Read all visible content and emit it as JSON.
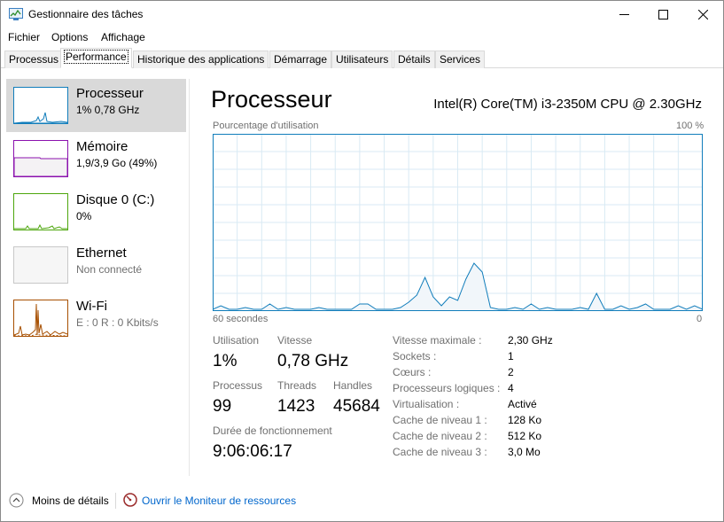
{
  "window": {
    "title": "Gestionnaire des tâches",
    "minimize_icon": "minimize-icon",
    "maximize_icon": "maximize-icon",
    "close_icon": "close-icon"
  },
  "menu": [
    "Fichier",
    "Options",
    "Affichage"
  ],
  "tabs": [
    "Processus",
    "Performance",
    "Historique des applications",
    "Démarrage",
    "Utilisateurs",
    "Détails",
    "Services"
  ],
  "active_tab": "Performance",
  "sidebar": {
    "items": [
      {
        "title": "Processeur",
        "subtitle": "1% 0,78 GHz",
        "color": "#117dbb"
      },
      {
        "title": "Mémoire",
        "subtitle": "1,9/3,9 Go (49%)",
        "color": "#8b12ae"
      },
      {
        "title": "Disque 0 (C:)",
        "subtitle": "0%",
        "color": "#4da60c"
      },
      {
        "title": "Ethernet",
        "subtitle": "Non connecté",
        "color": "#a74f01"
      },
      {
        "title": "Wi-Fi",
        "subtitle": "E : 0 R : 0 Kbits/s",
        "color": "#a74f01"
      }
    ]
  },
  "main": {
    "title": "Processeur",
    "cpu_name": "Intel(R) Core(TM) i3-2350M CPU @ 2.30GHz",
    "graph_top_left": "Pourcentage d'utilisation",
    "graph_top_right": "100 %",
    "graph_bottom_left": "60 secondes",
    "graph_bottom_right": "0",
    "stats": {
      "utilisation_label": "Utilisation",
      "utilisation_value": "1%",
      "vitesse_label": "Vitesse",
      "vitesse_value": "0,78 GHz",
      "processus_label": "Processus",
      "processus_value": "99",
      "threads_label": "Threads",
      "threads_value": "1423",
      "handles_label": "Handles",
      "handles_value": "45684",
      "uptime_label": "Durée de fonctionnement",
      "uptime_value": "9:06:06:17"
    },
    "details": [
      {
        "label": "Vitesse maximale :",
        "value": "2,30 GHz"
      },
      {
        "label": "Sockets :",
        "value": "1"
      },
      {
        "label": "Cœurs :",
        "value": "2"
      },
      {
        "label": "Processeurs logiques :",
        "value": "4"
      },
      {
        "label": "Virtualisation :",
        "value": "Activé"
      },
      {
        "label": "Cache de niveau 1 :",
        "value": "128 Ko"
      },
      {
        "label": "Cache de niveau 2 :",
        "value": "512 Ko"
      },
      {
        "label": "Cache de niveau 3 :",
        "value": "3,0 Mo"
      }
    ]
  },
  "footer": {
    "less_details": "Moins de détails",
    "resource_monitor": "Ouvrir le Moniteur de ressources"
  },
  "colors": {
    "cpu_line": "#117dbb",
    "cpu_fill": "#f1f6fa",
    "grid": "#d9eaf4",
    "link": "#0066cc"
  },
  "chart_data": {
    "type": "area",
    "title": "",
    "xlabel": "60 secondes",
    "ylabel": "Pourcentage d'utilisation",
    "ylim": [
      0,
      100
    ],
    "x": [
      60,
      59,
      58,
      57,
      56,
      55,
      54,
      53,
      52,
      51,
      50,
      49,
      48,
      47,
      46,
      45,
      44,
      43,
      42,
      41,
      40,
      39,
      38,
      37,
      36,
      35,
      34,
      33,
      32,
      31,
      30,
      29,
      28,
      27,
      26,
      25,
      24,
      23,
      22,
      21,
      20,
      19,
      18,
      17,
      16,
      15,
      14,
      13,
      12,
      11,
      10,
      9,
      8,
      7,
      6,
      5,
      4,
      3,
      2,
      1,
      0
    ],
    "series": [
      {
        "values": [
          1,
          3,
          1,
          1,
          2,
          1,
          1,
          4,
          1,
          2,
          1,
          1,
          1,
          2,
          1,
          1,
          1,
          1,
          4,
          4,
          1,
          1,
          1,
          2,
          5,
          9,
          19,
          8,
          3,
          8,
          6,
          18,
          27,
          22,
          2,
          1,
          1,
          2,
          1,
          4,
          1,
          2,
          1,
          1,
          1,
          2,
          1,
          10,
          1,
          1,
          3,
          1,
          2,
          4,
          1,
          1,
          1,
          3,
          1,
          3,
          1
        ]
      }
    ]
  }
}
